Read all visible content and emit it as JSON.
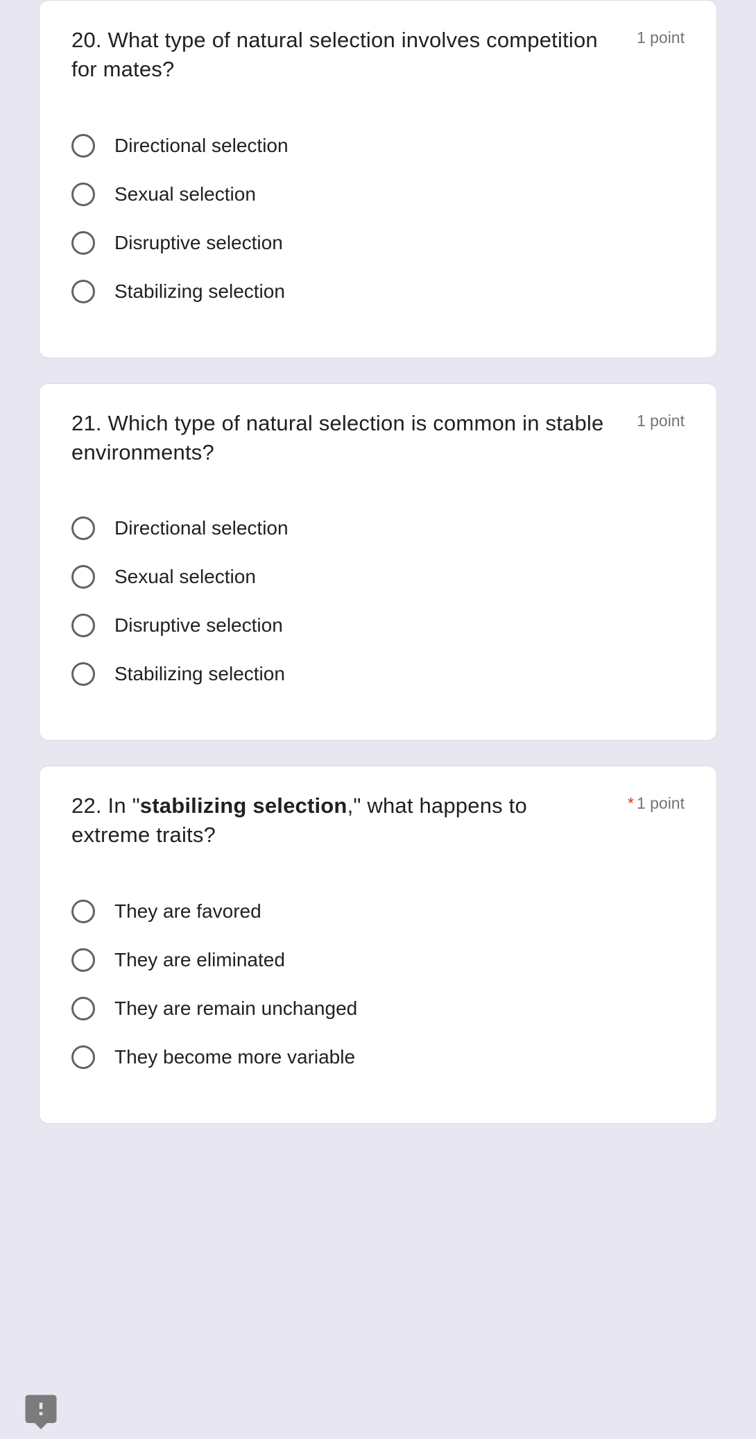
{
  "questions": [
    {
      "number": "20.",
      "text_before": "  What type of natural selection involves competition for mates?",
      "bold_part": "",
      "text_after": "",
      "required": false,
      "points": "1 point",
      "options": [
        "Directional selection",
        "Sexual selection",
        "Disruptive selection",
        "Stabilizing selection"
      ]
    },
    {
      "number": "21.",
      "text_before": "   Which type of natural selection is common in stable environments?",
      "bold_part": "",
      "text_after": "",
      "required": false,
      "points": "1 point",
      "options": [
        "Directional selection",
        "Sexual selection",
        "Disruptive selection",
        "Stabilizing selection"
      ]
    },
    {
      "number": "22.",
      "text_before": "  In \"",
      "bold_part": "stabilizing selection",
      "text_after": ",\" what happens to extreme traits?",
      "required": true,
      "points": "1 point",
      "options": [
        "They are favored",
        "They are eliminated",
        "They are remain unchanged",
        "They become more variable"
      ]
    }
  ],
  "required_marker": "*"
}
